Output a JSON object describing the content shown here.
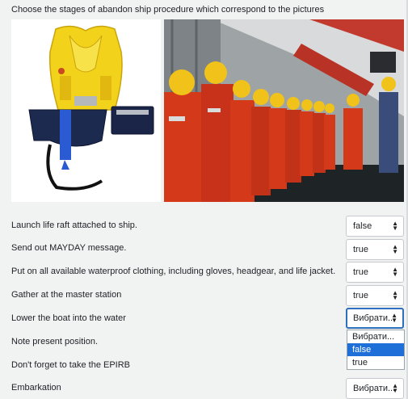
{
  "question": {
    "title": "Choose the stages of abandon ship procedure which correspond to the pictures"
  },
  "images": [
    {
      "icon": "life-jacket-photo"
    },
    {
      "icon": "crew-muster-photo"
    }
  ],
  "rows": [
    {
      "label": "Launch life raft attached to ship.",
      "value": "false"
    },
    {
      "label": "Send out MAYDAY message.",
      "value": "true"
    },
    {
      "label": "Put on all available waterproof clothing, including gloves, headgear, and life jacket.",
      "value": "true"
    },
    {
      "label": "Gather at the master station",
      "value": "true"
    },
    {
      "label": "Lower the boat into the water",
      "value": "Вибрати..."
    },
    {
      "label": "Note present position.",
      "value": ""
    },
    {
      "label": "Don't forget to take the EPIRB",
      "value": ""
    },
    {
      "label": "Embarkation",
      "value": "Вибрати..."
    }
  ],
  "dropdown": {
    "options": [
      "Вибрати...",
      "false",
      "true"
    ],
    "highlighted": "false"
  },
  "colors": {
    "focus_border": "#2f6fc0",
    "highlight": "#1e6fd8",
    "background": "#f1f3f2"
  }
}
